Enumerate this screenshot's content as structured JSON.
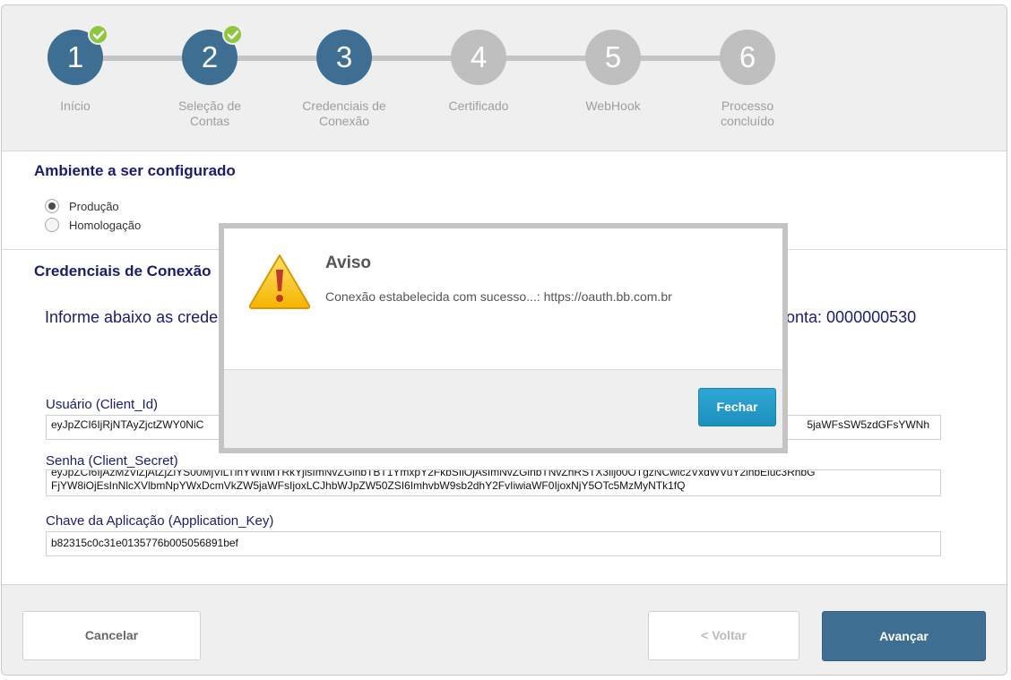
{
  "stepper": {
    "steps": [
      {
        "number": "1",
        "label": "Início",
        "state": "completed"
      },
      {
        "number": "2",
        "label": "Seleção de Contas",
        "state": "completed"
      },
      {
        "number": "3",
        "label": "Credenciais de Conexão",
        "state": "current"
      },
      {
        "number": "4",
        "label": "Certificado",
        "state": "pending"
      },
      {
        "number": "5",
        "label": "WebHook",
        "state": "pending"
      },
      {
        "number": "6",
        "label": "Processo concluído",
        "state": "pending"
      }
    ]
  },
  "environment": {
    "title": "Ambiente a ser configurado",
    "options": [
      {
        "label": "Produção",
        "checked": true
      },
      {
        "label": "Homologação",
        "checked": false
      }
    ]
  },
  "credentials": {
    "title": "Credenciais de Conexão",
    "info_left": "Informe abaixo as crede",
    "info_right": "onta: 0000000530",
    "client_id_label": "Usuário (Client_Id)",
    "client_id_value_start": "eyJpZCI6IjRjNTAyZjctZWY0NiC",
    "client_id_value_end": "5jaWFsSW5zdGFsYWNh",
    "client_secret_label": "Senha (Client_Secret)",
    "client_secret_line1": "eyJpZCI6IjAzMzViZjAtZjZiYS00MjViLTlhYWItMTRkYjlsImNvZGlnbTBT1YmxpY2FkbSIiOjAsImNvZGlnbTNvZhRSTX3iljo0OTgzNCwic2VxdWVuY2lhbEluc3RhbG",
    "client_secret_line2": "FjYW8iOjEsInNlcXVlbmNpYWxDcmVkZW5jaWFsIjoxLCJhbWJpZW50ZSI6ImhvbW9sb2dhY2FvIiwiaWF0IjoxNjY5OTc5MzMyNTk1fQ",
    "app_key_label": "Chave da Aplicação (Application_Key)",
    "app_key_value": "b82315c0c31e0135776b005056891bef"
  },
  "footer": {
    "cancel_label": "Cancelar",
    "back_label": "< Voltar",
    "next_label": "Avançar"
  },
  "modal": {
    "title": "Aviso",
    "message": "Conexão estabelecida com sucesso...: https://oauth.bb.com.br",
    "close_label": "Fechar",
    "icon": "warning-icon"
  },
  "colors": {
    "step_done": "#3e6f93",
    "step_pending": "#bfbfbf",
    "check_green": "#8dc63f",
    "title_navy": "#1b1b6f",
    "modal_button": "#1c8fbd"
  }
}
